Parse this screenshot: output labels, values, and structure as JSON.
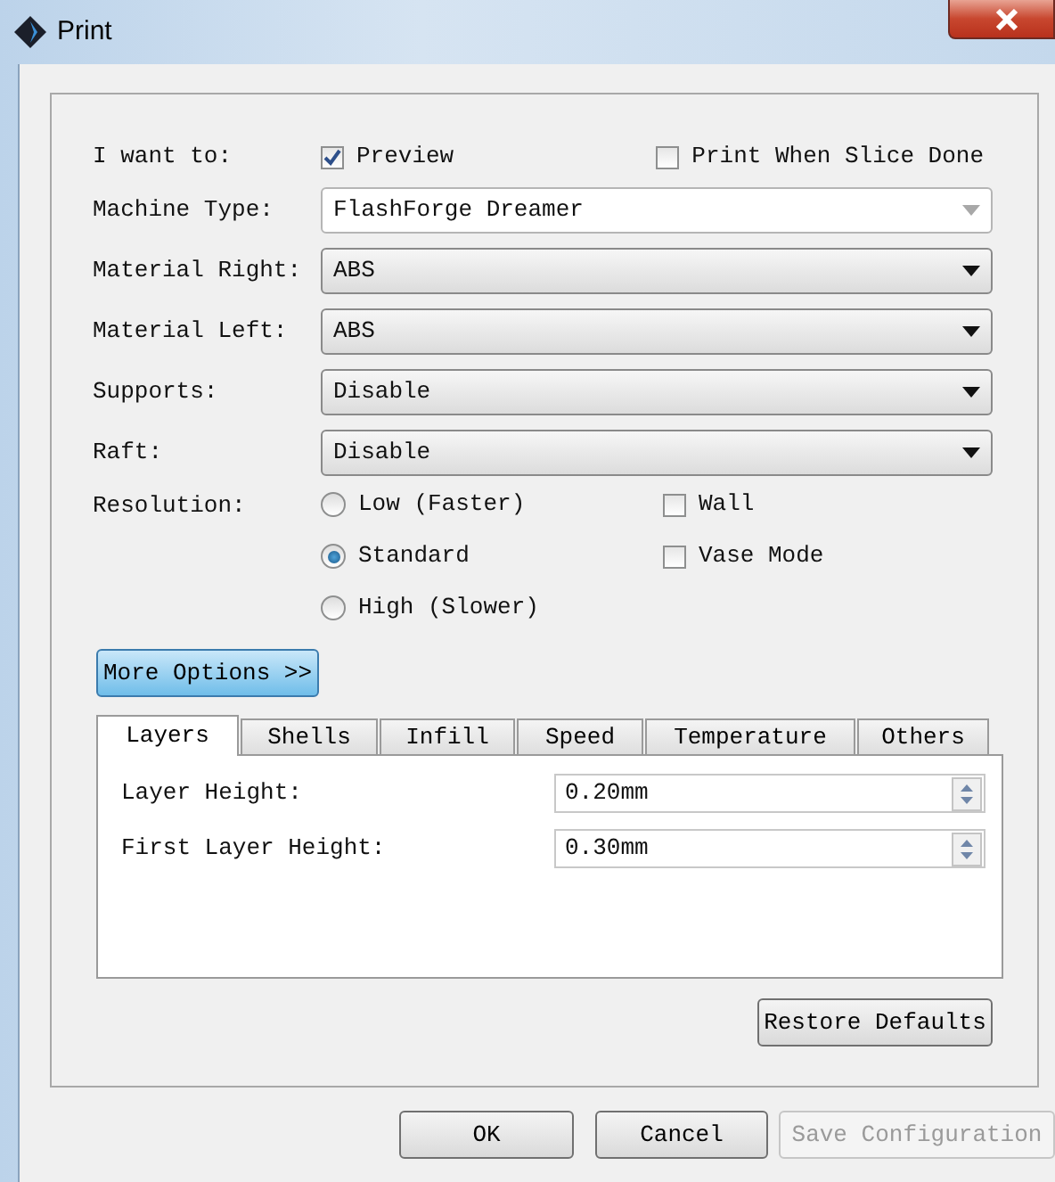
{
  "window": {
    "title": "Print"
  },
  "intent": {
    "label": "I want to:",
    "options": [
      {
        "label": "Preview",
        "checked": true
      },
      {
        "label": "Print When Slice Done",
        "checked": false
      }
    ]
  },
  "fields": [
    {
      "label": "Machine Type:",
      "value": "FlashForge Dreamer",
      "disabled": true
    },
    {
      "label": "Material Right:",
      "value": "ABS",
      "disabled": false
    },
    {
      "label": "Material Left:",
      "value": "ABS",
      "disabled": false
    },
    {
      "label": "Supports:",
      "value": "Disable",
      "disabled": false
    },
    {
      "label": "Raft:",
      "value": "Disable",
      "disabled": false
    }
  ],
  "resolution": {
    "label": "Resolution:",
    "options": [
      {
        "label": "Low (Faster)",
        "selected": false
      },
      {
        "label": "Standard",
        "selected": true
      },
      {
        "label": "High (Slower)",
        "selected": false
      }
    ],
    "toggles": [
      {
        "label": "Wall",
        "checked": false
      },
      {
        "label": "Vase Mode",
        "checked": false
      }
    ]
  },
  "more_options": "More Options >>",
  "tabs": [
    {
      "label": "Layers",
      "selected": true
    },
    {
      "label": "Shells",
      "selected": false
    },
    {
      "label": "Infill",
      "selected": false
    },
    {
      "label": "Speed",
      "selected": false
    },
    {
      "label": "Temperature",
      "selected": false
    },
    {
      "label": "Others",
      "selected": false
    }
  ],
  "settings": [
    {
      "label": "Layer Height:",
      "value": "0.20mm"
    },
    {
      "label": "First Layer Height:",
      "value": "0.30mm"
    }
  ],
  "restore": "Restore Defaults",
  "buttons": [
    {
      "label": "OK",
      "disabled": false
    },
    {
      "label": "Cancel",
      "disabled": false
    },
    {
      "label": "Save Configuration",
      "disabled": true
    }
  ]
}
